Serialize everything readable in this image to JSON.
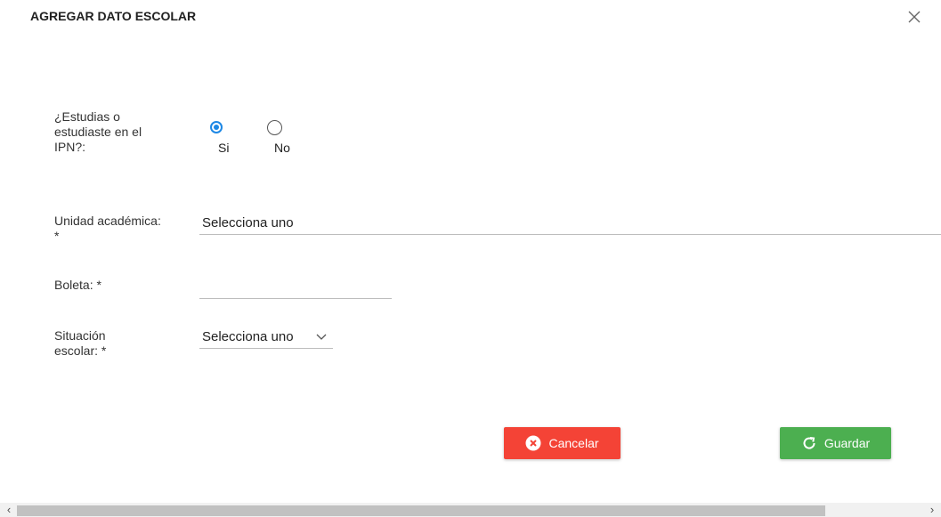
{
  "dialog": {
    "title": "AGREGAR DATO ESCOLAR"
  },
  "form": {
    "ipn_question": "¿Estudias o estudiaste en el IPN?:",
    "ipn_options": [
      {
        "label": "Si",
        "selected": true
      },
      {
        "label": "No",
        "selected": false
      }
    ],
    "unidad_label": "Unidad académica: *",
    "unidad_value": "Selecciona uno",
    "boleta_label": "Boleta: *",
    "boleta_value": "",
    "situacion_label": "Situación escolar: *",
    "situacion_value": "Selecciona uno"
  },
  "buttons": {
    "cancel_label": "Cancelar",
    "save_label": "Guardar"
  },
  "colors": {
    "cancel": "#f44336",
    "save": "#4caf50",
    "radio_accent": "#1e88e5"
  },
  "icons": {
    "close": "close-icon",
    "cancel": "cancel-circle-icon",
    "save": "refresh-icon",
    "dropdown": "chevron-down-icon",
    "scroll_left": "chevron-left-icon",
    "scroll_right": "chevron-right-icon"
  }
}
